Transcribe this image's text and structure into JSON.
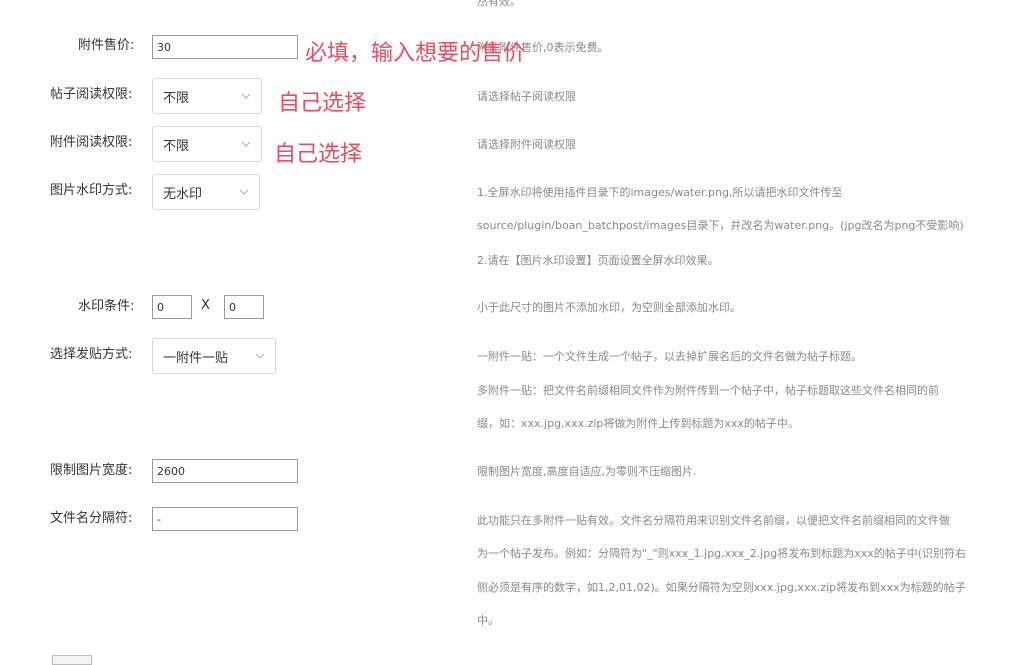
{
  "top_help": "然有效。",
  "rows": {
    "price": {
      "label": "附件售价:",
      "value": "30",
      "help": "附件附件售价,0表示免费。",
      "annotation": "必填，输入想要的售价"
    },
    "post_read": {
      "label": "帖子阅读权限:",
      "value": "不限",
      "help": "请选择帖子阅读权限",
      "annotation": "自己选择"
    },
    "attach_read": {
      "label": "附件阅读权限:",
      "value": "不限",
      "help": "请选择附件阅读权限",
      "annotation": "自己选择"
    },
    "watermark_mode": {
      "label": "图片水印方式:",
      "value": "无水印",
      "help_lines": [
        "1.全屏水印将使用插件目录下的images/water.png,所以请把水印文件传至",
        "source/plugin/boan_batchpost/images目录下，并改名为water.png。(jpg改名为png不受影响)",
        "2.请在【图片水印设置】页面设置全屏水印效果。"
      ]
    },
    "watermark_cond": {
      "label": "水印条件:",
      "width_value": "0",
      "x_label": "X",
      "height_value": "0",
      "help": "小于此尺寸的图片不添加水印，为空则全部添加水印。"
    },
    "post_mode": {
      "label": "选择发贴方式:",
      "value": "一附件一贴",
      "help_lines": [
        "一附件一贴：一个文件生成一个帖子，以去掉扩展名后的文件名做为帖子标题。",
        "多附件一贴：把文件名前缀相同文件作为附件传到一个帖子中，帖子标题取这些文件名相同的前",
        "缀，如：xxx.jpg,xxx.zip将做为附件上传到标题为xxx的帖子中。"
      ]
    },
    "img_width": {
      "label": "限制图片宽度:",
      "value": "2600",
      "help": "限制图片宽度,高度自适应,为零则不压缩图片."
    },
    "separator": {
      "label": "文件名分隔符:",
      "value": "-",
      "help_lines": [
        "此功能只在多附件一贴有效。文件名分隔符用来识别文件名前缀，以便把文件名前缀相同的文件做",
        "为一个帖子发布。例如：分隔符为\"_\"则xxx_1.jpg,xxx_2.jpg将发布到标题为xxx的帖子中(识别符右",
        "侧必须是有序的数字，如1,2,01,02)。如果分隔符为空则xxx.jpg,xxx.zip将发布到xxx为标题的帖子",
        "中。"
      ]
    }
  },
  "icons": {
    "select_arrow": "chevron-down-icon"
  },
  "colors": {
    "annotation": "#e84c5e",
    "help_text": "#888888"
  }
}
